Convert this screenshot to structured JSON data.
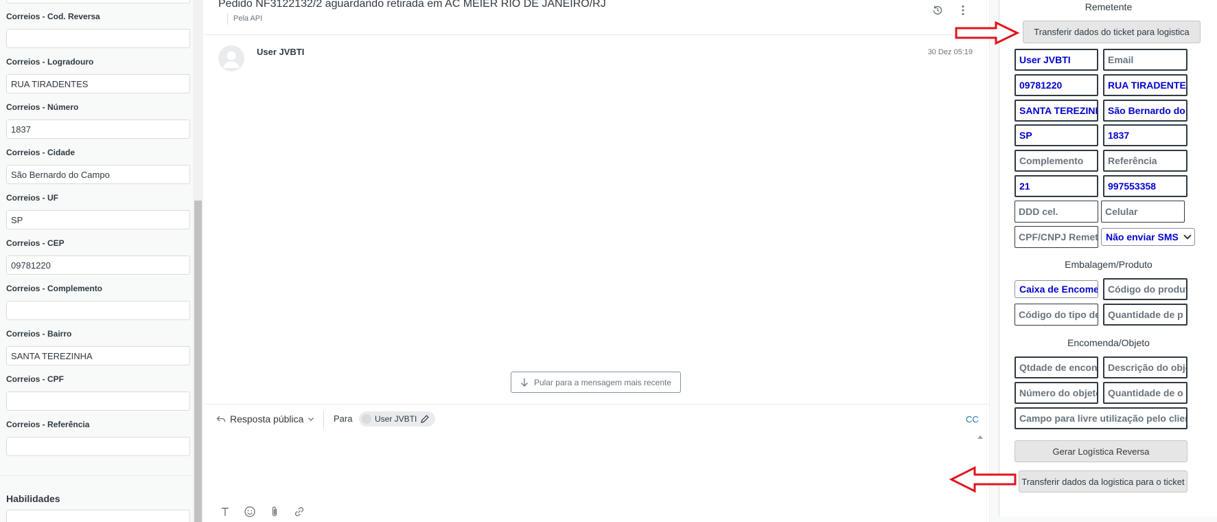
{
  "left_panel": {
    "fields": [
      {
        "label": "Correios - Cod. Reversa",
        "value": ""
      },
      {
        "label": "Correios - Logradouro",
        "value": "RUA TIRADENTES"
      },
      {
        "label": "Correios - Número",
        "value": "1837"
      },
      {
        "label": "Correios - Cidade",
        "value": "São Bernardo do Campo"
      },
      {
        "label": "Correios - UF",
        "value": "SP"
      },
      {
        "label": "Correios - CEP",
        "value": "09781220"
      },
      {
        "label": "Correios - Complemento",
        "value": ""
      },
      {
        "label": "Correios - Bairro",
        "value": "SANTA TEREZINHA"
      },
      {
        "label": "Correios - CPF",
        "value": ""
      },
      {
        "label": "Correios - Referência",
        "value": ""
      }
    ],
    "skills_label": "Habilidades"
  },
  "main": {
    "ticket_title": "Pedido NF3122132/2 aguardando retirada em  AC MEIER RIO DE JANEIRO/RJ",
    "ticket_via": "Pela API",
    "message": {
      "author": "User JVBTI",
      "time": "30 Dez 05:19"
    },
    "jump_button": "Pular para a mensagem mais recente",
    "composer": {
      "reply_type": "Resposta pública",
      "to_label": "Para",
      "recipient": "User JVBTI",
      "cc": "CC"
    },
    "toolbar_icons": [
      "text-format-icon",
      "emoji-icon",
      "attachment-icon",
      "link-icon"
    ]
  },
  "right_panel": {
    "sender_title": "Remetente",
    "transfer_to_logistics": "Transferir dados do ticket para logistica",
    "sender_fields": {
      "name": "User JVBTI",
      "email": "Email",
      "cep": "09781220",
      "street": "RUA TIRADENTES",
      "district": "SANTA TEREZINHA",
      "city": "São Bernardo do C",
      "uf": "SP",
      "number": "1837",
      "complement": "Complemento",
      "reference": "Referência",
      "ddd": "21",
      "phone": "997553358",
      "ddd_cel": "DDD cel.",
      "cel": "Celular",
      "cpf": "CPF/CNPJ Remetente",
      "sms_option": "Não enviar SMS"
    },
    "package_title": "Embalagem/Produto",
    "package_fields": {
      "packaging_select": "Caixa de Encomenda",
      "product_code": "Código do produto",
      "type_code": "Código do tipo de p",
      "quantity": "Quantidade de p"
    },
    "object_title": "Encomenda/Objeto",
    "object_fields": {
      "qty": "Qtdade de encon",
      "description": "Descrição do objet",
      "number": "Número do objeto/c",
      "quantity": "Quantidade de o",
      "free_field": "Campo para livre utilização pelo cliente"
    },
    "generate_button": "Gerar Logística Reversa",
    "transfer_to_ticket": "Transferir dados da logistica para o ticket"
  },
  "colors": {
    "filled_text": "#0000cc",
    "arrow": "#e0141e",
    "link": "#1f73b7"
  }
}
